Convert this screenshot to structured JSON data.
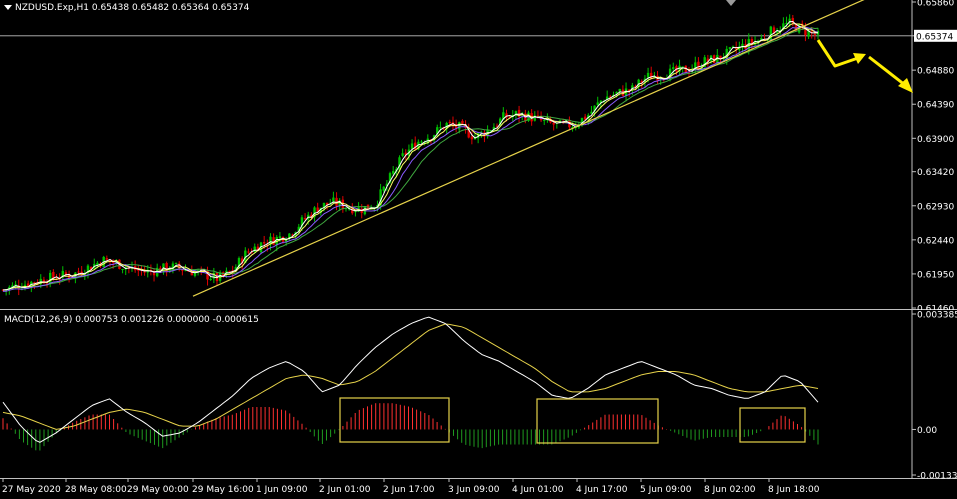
{
  "window": {
    "symbol_title": "NZDUSD.Exp,H1  0.65438 0.65482 0.65364 0.65374",
    "macd_title": "MACD(12,26,9) 0.000753 0.001226 0.000000 -0.000615"
  },
  "colors": {
    "background": "#000000",
    "bull_candle": "#00c000",
    "bear_candle": "#e00000",
    "ma_fast": "#ffffff",
    "ma_mid": "#ffff66",
    "ma_slow_purple": "#8a5cff",
    "ma_slow_green": "#3fa83f",
    "trendline": "#e6d24a",
    "arrow": "#ffee00",
    "macd_line": "#ffffff",
    "signal_line": "#e6d24a",
    "hist_pos": "#ff3030",
    "hist_neg": "#1f9a1f",
    "highlight_box": "#e6d24a",
    "current_price_line": "#c0c0c0"
  },
  "chart_data": [
    {
      "type": "candlestick",
      "title": "NZDUSD.Exp,H1",
      "timeframe": "H1",
      "ohlc_last": {
        "open": 0.65438,
        "high": 0.65482,
        "low": 0.65364,
        "close": 0.65374
      },
      "current_price_label": "0.65374",
      "y_ticks": [
        "0.65860",
        "0.65374",
        "0.64880",
        "0.64390",
        "0.63900",
        "0.63420",
        "0.62930",
        "0.62440",
        "0.61950",
        "0.61460"
      ],
      "ylim": [
        0.6146,
        0.6586
      ],
      "x_ticks": [
        "27 May 2020",
        "28 May 08:00",
        "29 May 00:00",
        "29 May 16:00",
        "1 Jun 09:00",
        "2 Jun 01:00",
        "2 Jun 17:00",
        "3 Jun 09:00",
        "4 Jun 01:00",
        "4 Jun 17:00",
        "5 Jun 09:00",
        "8 Jun 02:00",
        "8 Jun 18:00"
      ],
      "close_path": [
        0.6172,
        0.6178,
        0.6183,
        0.6188,
        0.6192,
        0.6195,
        0.6205,
        0.6215,
        0.621,
        0.6202,
        0.6198,
        0.6202,
        0.6205,
        0.62,
        0.6195,
        0.6188,
        0.6198,
        0.6225,
        0.6238,
        0.6245,
        0.6252,
        0.6272,
        0.629,
        0.6298,
        0.6292,
        0.6288,
        0.6295,
        0.633,
        0.6365,
        0.6385,
        0.6395,
        0.641,
        0.6405,
        0.6392,
        0.6402,
        0.642,
        0.6425,
        0.642,
        0.6412,
        0.6408,
        0.641,
        0.6425,
        0.6448,
        0.6455,
        0.646,
        0.6478,
        0.6482,
        0.6485,
        0.649,
        0.65,
        0.6505,
        0.6515,
        0.6525,
        0.6532,
        0.6548,
        0.6555,
        0.6545,
        0.6537
      ],
      "moving_averages": [
        "fast (white)",
        "mid (yellow)",
        "slow (purple)",
        "slowest (green)"
      ],
      "trendline": {
        "from_price": 0.6163,
        "to_price": 0.6592
      },
      "annotation_arrows": "projected decline after 8 Jun 18:00"
    },
    {
      "type": "macd",
      "title": "MACD(12,26,9)",
      "params": [
        12,
        26,
        9
      ],
      "values": {
        "macd": 0.000753,
        "signal": 0.001226,
        "zero": 0.0,
        "histogram": -0.000615
      },
      "y_ticks": [
        "0.003385",
        "0.00",
        "-0.001335"
      ],
      "ylim": [
        -0.001335,
        0.003385
      ],
      "macd_line": [
        0.0008,
        0.0001,
        -0.0004,
        -0.0001,
        0.0003,
        0.0007,
        0.0009,
        0.0005,
        0.0002,
        -0.0002,
        -0.0001,
        0.0002,
        0.0006,
        0.001,
        0.0015,
        0.0018,
        0.002,
        0.0017,
        0.0011,
        0.0013,
        0.0019,
        0.0024,
        0.0028,
        0.0031,
        0.0033,
        0.0031,
        0.0026,
        0.0022,
        0.002,
        0.0017,
        0.0014,
        0.001,
        0.0009,
        0.0012,
        0.0016,
        0.0018,
        0.002,
        0.0018,
        0.0016,
        0.0013,
        0.0012,
        0.001,
        0.0009,
        0.0011,
        0.0016,
        0.0014,
        0.0008
      ],
      "signal_line": [
        0.0005,
        0.0004,
        0.0002,
        0.0,
        0.0001,
        0.0003,
        0.0005,
        0.0006,
        0.0005,
        0.0003,
        0.0001,
        0.0001,
        0.0003,
        0.0006,
        0.0009,
        0.0012,
        0.0015,
        0.0016,
        0.0015,
        0.0013,
        0.0014,
        0.0017,
        0.0021,
        0.0025,
        0.0029,
        0.0031,
        0.003,
        0.0027,
        0.0024,
        0.0021,
        0.0018,
        0.0014,
        0.0011,
        0.0011,
        0.0012,
        0.0014,
        0.0016,
        0.0017,
        0.0017,
        0.0016,
        0.0014,
        0.0012,
        0.0011,
        0.0011,
        0.0012,
        0.0013,
        0.0012
      ],
      "highlight_boxes": [
        "2 Jun 01:00 – 2 Jun 17:00",
        "4 Jun 01:00 – 5 Jun 09:00",
        "8 Jun 18:00"
      ]
    }
  ]
}
